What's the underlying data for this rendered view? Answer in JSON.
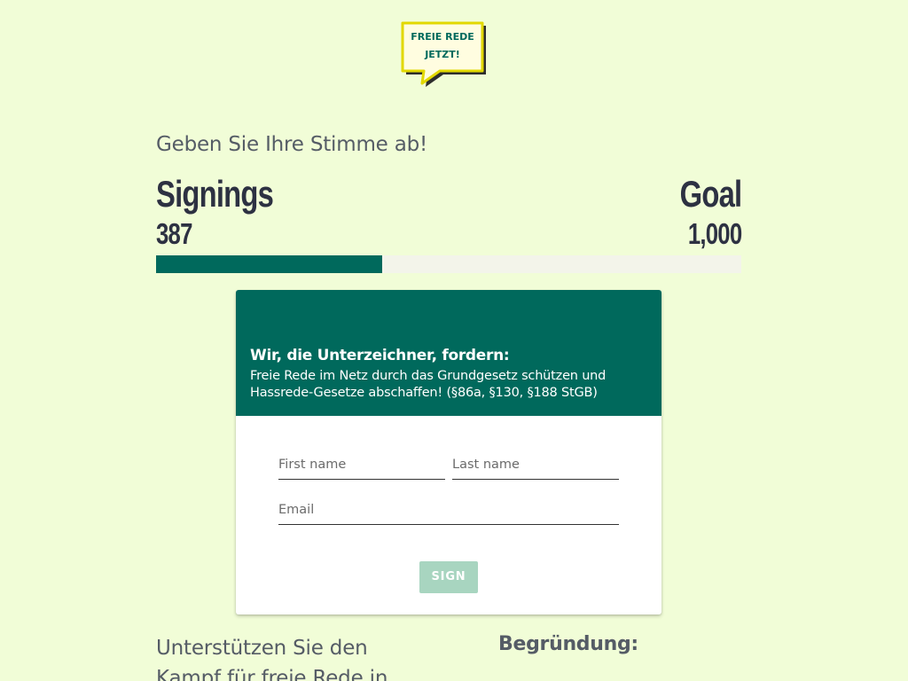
{
  "logo": {
    "line1": "FREIE REDE",
    "line2": "JETZT!",
    "colors": {
      "bubble": "#fffde0",
      "border": "#e2d800",
      "shadow": "#2d2d2d",
      "text": "#00695c"
    }
  },
  "intro": "Geben Sie Ihre Stimme ab!",
  "counter": {
    "signings_label": "Signings",
    "signings_value": "387",
    "goal_label": "Goal",
    "goal_value": "1,000",
    "progress_fraction": 0.387
  },
  "card": {
    "title": "Wir, die Unterzeichner, fordern:",
    "text": "Freie Rede im Netz durch das Grundgesetz schützen und Hassrede-Gesetze abschaffen! (§86a, §130, §188 StGB)",
    "first_name_placeholder": "First name",
    "last_name_placeholder": "Last name",
    "email_placeholder": "Email",
    "sign_label": "SIGN"
  },
  "bottom": {
    "support": "Unterstützen Sie den Kampf für freie Rede in",
    "reason": "Begründung:"
  },
  "colors": {
    "background": "#f1fdd7",
    "accent": "#00695c",
    "button_disabled": "#a8d5c0",
    "dark_text": "#2d3142"
  }
}
